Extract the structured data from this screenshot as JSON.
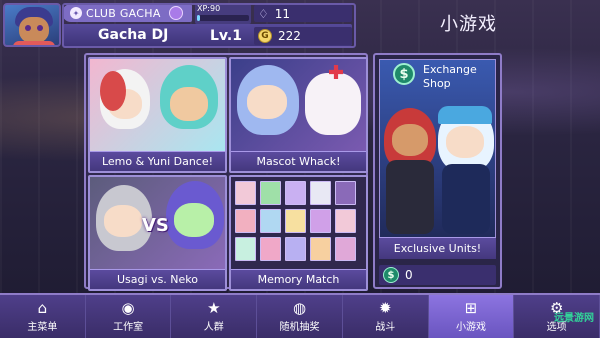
{
  "header": {
    "club_label": "CLUB GACHA",
    "player_name": "Gacha DJ",
    "xp_label": "XP:90",
    "xp_progress": 0.05,
    "level_label": "Lv.1",
    "gems": "11",
    "gold_symbol": "G",
    "gold": "222"
  },
  "page_title": "小游戏",
  "games": [
    {
      "label": "Lemo & Yuni Dance!"
    },
    {
      "label": "Mascot Whack!"
    },
    {
      "label": "Usagi vs. Neko",
      "badge": "VS"
    },
    {
      "label": "Memory Match"
    }
  ],
  "shop": {
    "title_line1": "Exchange",
    "title_line2": "Shop",
    "subtitle": "Exclusive Units!",
    "balance": "0",
    "currency_symbol": "$"
  },
  "nav": [
    {
      "label": "主菜单",
      "icon": "home-icon"
    },
    {
      "label": "工作室",
      "icon": "camera-icon"
    },
    {
      "label": "人群",
      "icon": "star-icon"
    },
    {
      "label": "随机抽奖",
      "icon": "gacha-icon"
    },
    {
      "label": "战斗",
      "icon": "battle-icon"
    },
    {
      "label": "小游戏",
      "icon": "gamepad-icon",
      "active": true
    },
    {
      "label": "选项",
      "icon": "settings-icon"
    }
  ],
  "watermark": "远景游网"
}
